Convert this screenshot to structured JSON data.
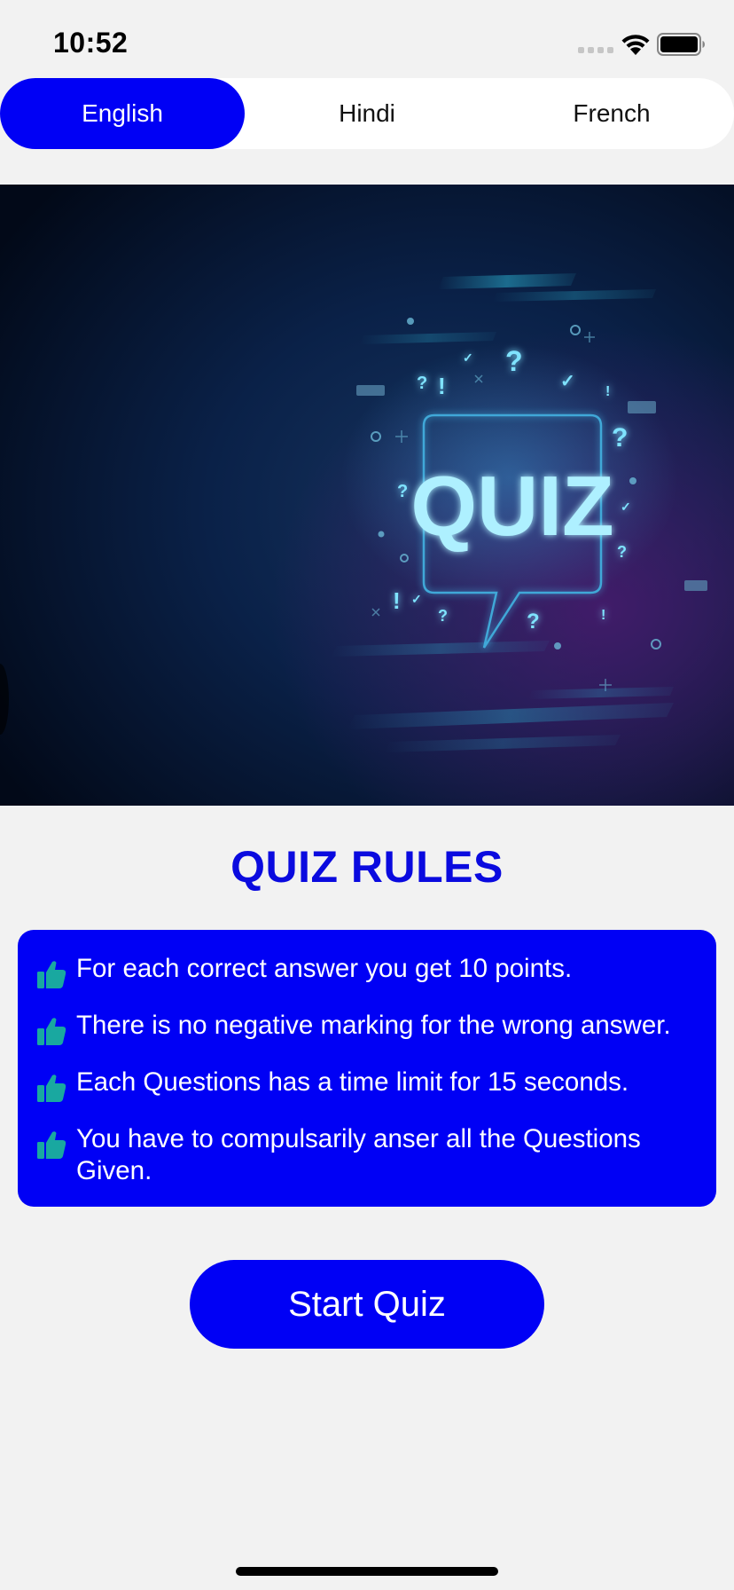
{
  "status_bar": {
    "time": "10:52"
  },
  "language_tabs": [
    {
      "label": "English",
      "active": true
    },
    {
      "label": "Hindi",
      "active": false
    },
    {
      "label": "French",
      "active": false
    }
  ],
  "hero": {
    "text": "QUIZ"
  },
  "rules": {
    "title": "QUIZ RULES",
    "items": [
      {
        "text": "For each correct answer you get 10 points.",
        "icon": "thumbs-up-icon"
      },
      {
        "text": "There is no negative marking for the wrong answer.",
        "icon": "thumbs-up-icon"
      },
      {
        "text": "Each Questions has a time limit for 15 seconds.",
        "icon": "thumbs-up-icon"
      },
      {
        "text": "You have to compulsarily anser all the Questions Given.",
        "icon": "thumbs-up-icon"
      }
    ]
  },
  "start_button": {
    "label": "Start Quiz"
  },
  "colors": {
    "accent": "#0000f5",
    "title": "#0a0adf",
    "icon": "#19a8a0",
    "background": "#f2f2f2"
  }
}
